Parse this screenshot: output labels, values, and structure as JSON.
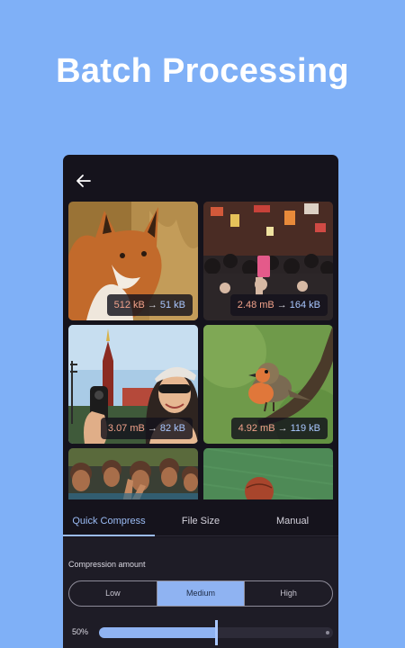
{
  "promo": {
    "headline": "Batch Processing"
  },
  "toolbar": {
    "back_icon": "arrow-left-icon"
  },
  "images": [
    {
      "subject": "fox",
      "original_size": "512 kB",
      "arrow": "→",
      "compressed_size": "51 kB"
    },
    {
      "subject": "crowd-street",
      "original_size": "2.48 mB",
      "arrow": "→",
      "compressed_size": "164 kB"
    },
    {
      "subject": "selfie-kremlin",
      "original_size": "3.07 mB",
      "arrow": "→",
      "compressed_size": "82 kB"
    },
    {
      "subject": "robin-bird",
      "original_size": "4.92 mB",
      "arrow": "→",
      "compressed_size": "119 kB"
    },
    {
      "subject": "group-children",
      "original_size": "",
      "arrow": "",
      "compressed_size": ""
    },
    {
      "subject": "ball-on-grass",
      "original_size": "",
      "arrow": "",
      "compressed_size": ""
    }
  ],
  "tabs": [
    {
      "label": "Quick Compress",
      "active": true
    },
    {
      "label": "File Size",
      "active": false
    },
    {
      "label": "Manual",
      "active": false
    }
  ],
  "compression": {
    "label": "Compression amount",
    "options": [
      {
        "label": "Low",
        "selected": false
      },
      {
        "label": "Medium",
        "selected": true
      },
      {
        "label": "High",
        "selected": false
      }
    ],
    "quality_label": "50%",
    "quality_fraction": 0.5
  },
  "colors": {
    "background": "#7fb0f7",
    "panel": "#15131c",
    "accent": "#8fb3f2",
    "original_size_text": "#f1a28b",
    "compressed_size_text": "#a9c7ff"
  }
}
